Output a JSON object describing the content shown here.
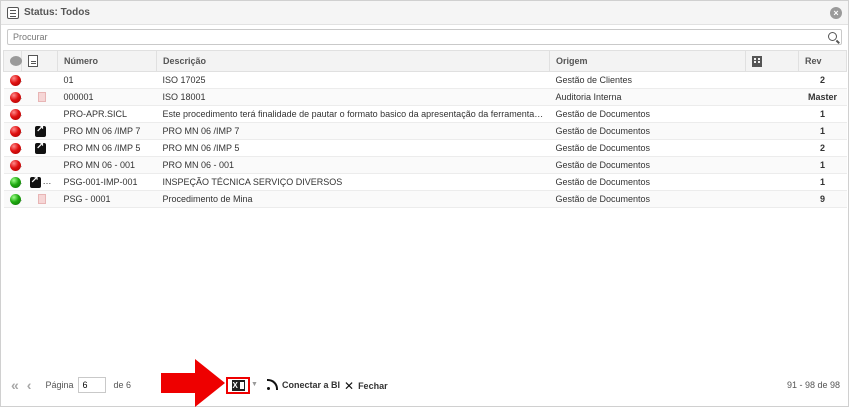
{
  "window": {
    "title": "Status: Todos"
  },
  "search": {
    "placeholder": "Procurar"
  },
  "table": {
    "columns": {
      "numero": "Número",
      "descricao": "Descrição",
      "origem": "Origem",
      "rev": "Rev"
    },
    "rows": [
      {
        "status": "red",
        "link": false,
        "pdf": false,
        "numero": "01",
        "descricao": "ISO 17025",
        "origem": "Gestão de Clientes",
        "rev": "2"
      },
      {
        "status": "red",
        "link": false,
        "pdf": true,
        "numero": "000001",
        "descricao": "ISO 18001",
        "origem": "Auditoria Interna",
        "rev": "Master"
      },
      {
        "status": "red",
        "link": false,
        "pdf": false,
        "numero": "PRO-APR.SICL",
        "descricao": "Este procedimento terá finalidade de pautar o formato basico da apresentação da ferramenta SI...",
        "origem": "Gestão de Documentos",
        "rev": "1"
      },
      {
        "status": "red",
        "link": true,
        "pdf": false,
        "numero": "PRO MN 06 /IMP 7",
        "descricao": "PRO MN 06 /IMP 7",
        "origem": "Gestão de Documentos",
        "rev": "1"
      },
      {
        "status": "red",
        "link": true,
        "pdf": false,
        "numero": "PRO MN 06 /IMP 5",
        "descricao": "PRO MN 06 /IMP 5",
        "origem": "Gestão de Documentos",
        "rev": "2"
      },
      {
        "status": "red",
        "link": false,
        "pdf": false,
        "numero": "PRO MN 06 - 001",
        "descricao": "PRO MN 06 - 001",
        "origem": "Gestão de Documentos",
        "rev": "1"
      },
      {
        "status": "green",
        "link": true,
        "pdf": true,
        "numero": "PSG-001-IMP-001",
        "descricao": "INSPEÇÃO TÉCNICA SERVIÇO DIVERSOS",
        "origem": "Gestão de Documentos",
        "rev": "1"
      },
      {
        "status": "green",
        "link": false,
        "pdf": true,
        "numero": "PSG - 0001",
        "descricao": "Procedimento de Mina",
        "origem": "Gestão de Documentos",
        "rev": "9"
      }
    ]
  },
  "footer": {
    "page_label": "Página",
    "page_value": "6",
    "of_label": "de 6",
    "connect_bi": "Conectar a BI",
    "close": "Fechar",
    "range": "91 - 98 de 98"
  },
  "colors": {
    "status_red": "#e01010",
    "status_green": "#1faa10",
    "highlight": "#ee0000"
  }
}
